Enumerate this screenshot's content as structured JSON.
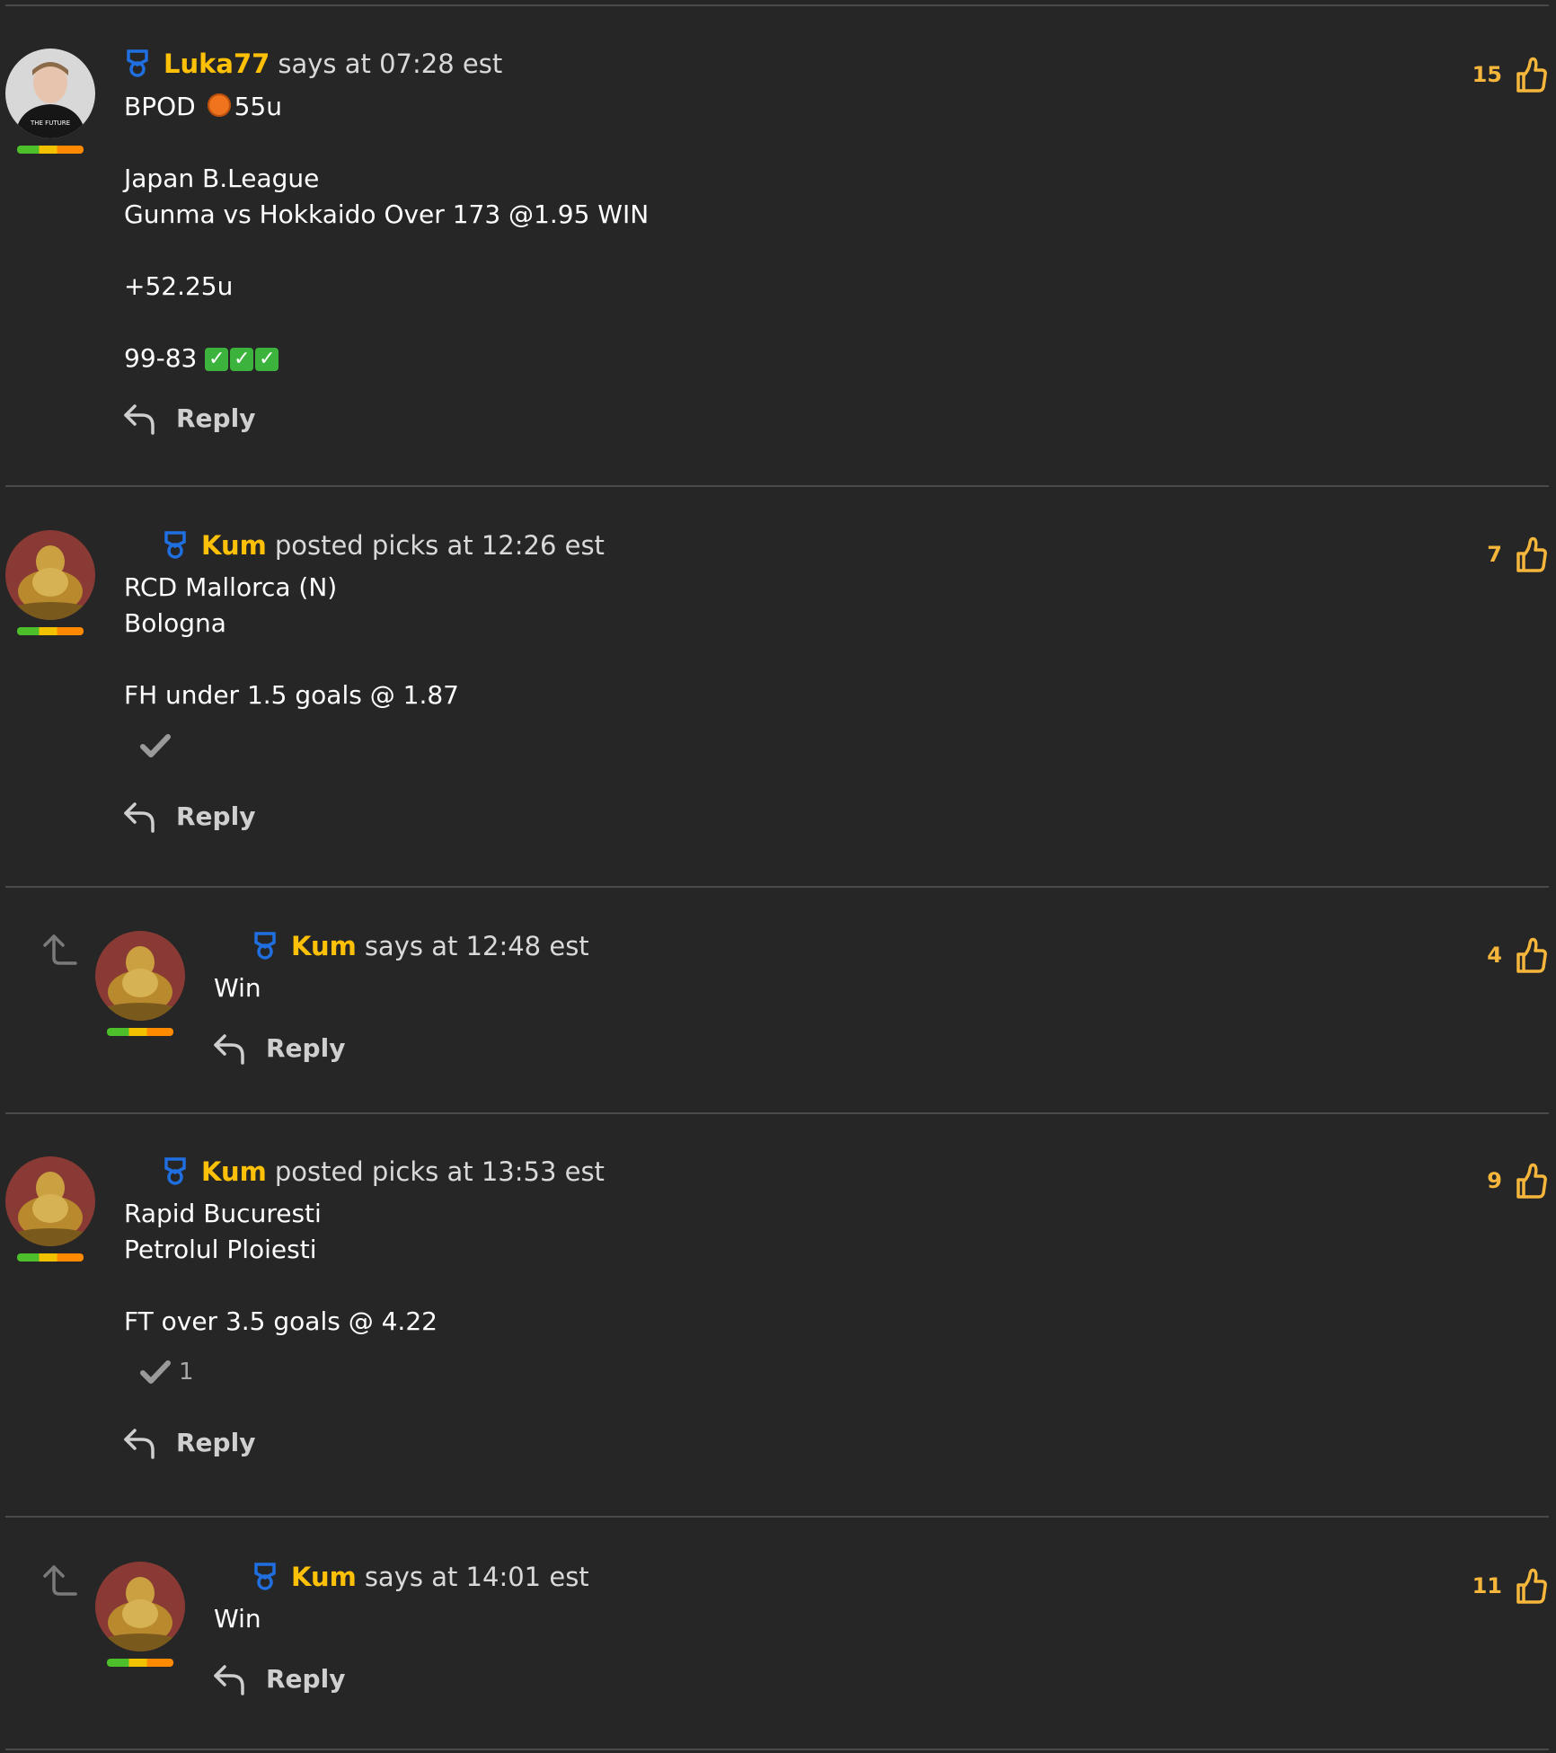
{
  "comments": [
    {
      "username": "Luka77",
      "action": "says at 07:28 est",
      "line1_pre": "BPOD",
      "line1_post": "55u",
      "lines": [
        "Japan B.League",
        "Gunma vs Hokkaido Over 173 @1.95 WIN",
        "",
        "+52.25u",
        ""
      ],
      "score_text": "99-83",
      "reply_label": "Reply",
      "likes": "15"
    },
    {
      "username": "Kum",
      "action": "posted picks at 12:26 est",
      "body": "RCD Mallorca (N)\nBologna\n\nFH under 1.5 goals @ 1.87",
      "check_count": "",
      "reply_label": "Reply",
      "likes": "7"
    },
    {
      "username": "Kum",
      "action": "says at 12:48 est",
      "body": "Win",
      "reply_label": "Reply",
      "likes": "4"
    },
    {
      "username": "Kum",
      "action": "posted picks at 13:53 est",
      "body": "Rapid Bucuresti\nPetrolul Ploiesti\n\nFT over 3.5 goals @ 4.22",
      "check_count": "1",
      "reply_label": "Reply",
      "likes": "9"
    },
    {
      "username": "Kum",
      "action": "says at 14:01 est",
      "body": "Win",
      "reply_label": "Reply",
      "likes": "11"
    }
  ],
  "avatar_caption": "THE FUTURE",
  "colors": {
    "username": "#ffc107",
    "likes": "#f5b63b",
    "background": "#262626",
    "badge": "#1f6fe0"
  }
}
